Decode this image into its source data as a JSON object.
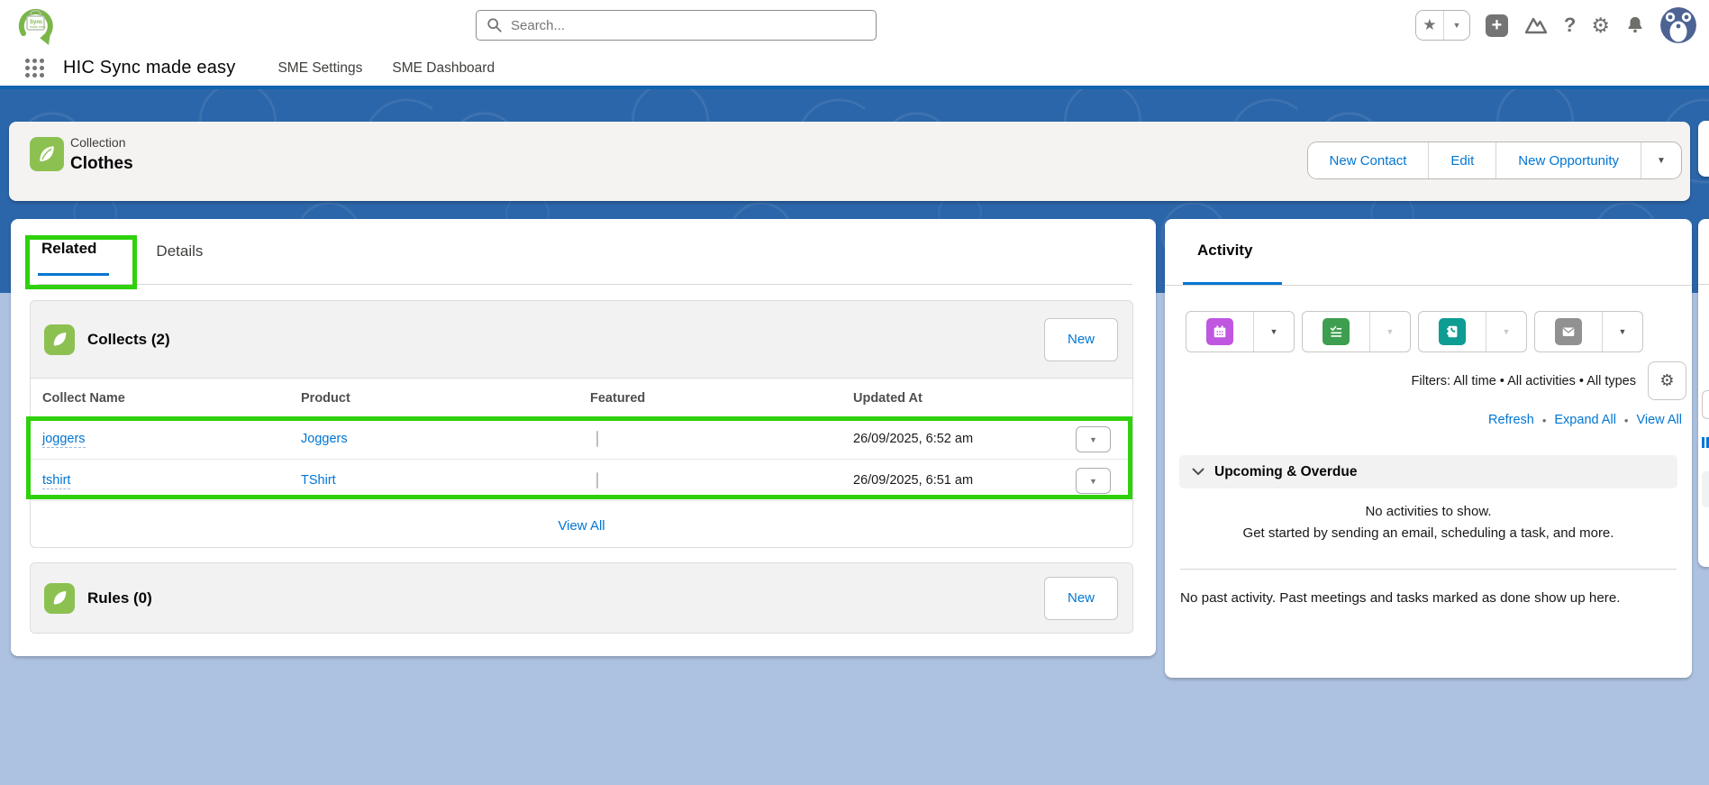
{
  "global_header": {
    "search": {
      "placeholder": "Search..."
    },
    "icons": {
      "star": "★",
      "chevron_down": "▼",
      "plus": "+",
      "help": "?",
      "gear": "⚙",
      "bullet": "•"
    }
  },
  "nav": {
    "app_name": "HIC Sync made easy",
    "tabs": [
      {
        "label": "SME Settings"
      },
      {
        "label": "SME Dashboard"
      }
    ]
  },
  "page_header": {
    "entity": "Collection",
    "title": "Clothes",
    "actions": {
      "new_contact": "New Contact",
      "edit": "Edit",
      "new_opportunity": "New Opportunity"
    }
  },
  "record_tabs": {
    "related": "Related",
    "details": "Details"
  },
  "collects": {
    "title": "Collects (2)",
    "new_label": "New",
    "columns": {
      "name": "Collect Name",
      "product": "Product",
      "featured": "Featured",
      "updated": "Updated At"
    },
    "rows": [
      {
        "name": "joggers",
        "product": "Joggers",
        "featured": false,
        "updated": "26/09/2025, 6:52 am"
      },
      {
        "name": "tshirt",
        "product": "TShirt",
        "featured": false,
        "updated": "26/09/2025, 6:51 am"
      }
    ],
    "view_all": "View All"
  },
  "rules": {
    "title": "Rules (0)",
    "new_label": "New"
  },
  "activity": {
    "title": "Activity",
    "filters": "Filters: All time • All activities • All types",
    "links": {
      "refresh": "Refresh",
      "expand_all": "Expand All",
      "view_all": "View All"
    },
    "bullet": "•",
    "upcoming_header": "Upcoming & Overdue",
    "empty_primary": "No activities to show.",
    "empty_secondary": "Get started by sending an email, scheduling a task, and more.",
    "past_empty": "No past activity. Past meetings and tasks marked as done show up here."
  },
  "colors": {
    "annotation_green": "#2ED10C",
    "brand_blue": "#0176d3",
    "nav_border_blue": "#1464AF",
    "leaf_icon_green": "#8CC152",
    "event_purple": "#BF57E0",
    "task_green": "#3E9E4F",
    "call_teal": "#0E9C93",
    "email_gray": "#919191",
    "band_blue": "#2C66AA",
    "page_bg": "#ADC1E0"
  }
}
